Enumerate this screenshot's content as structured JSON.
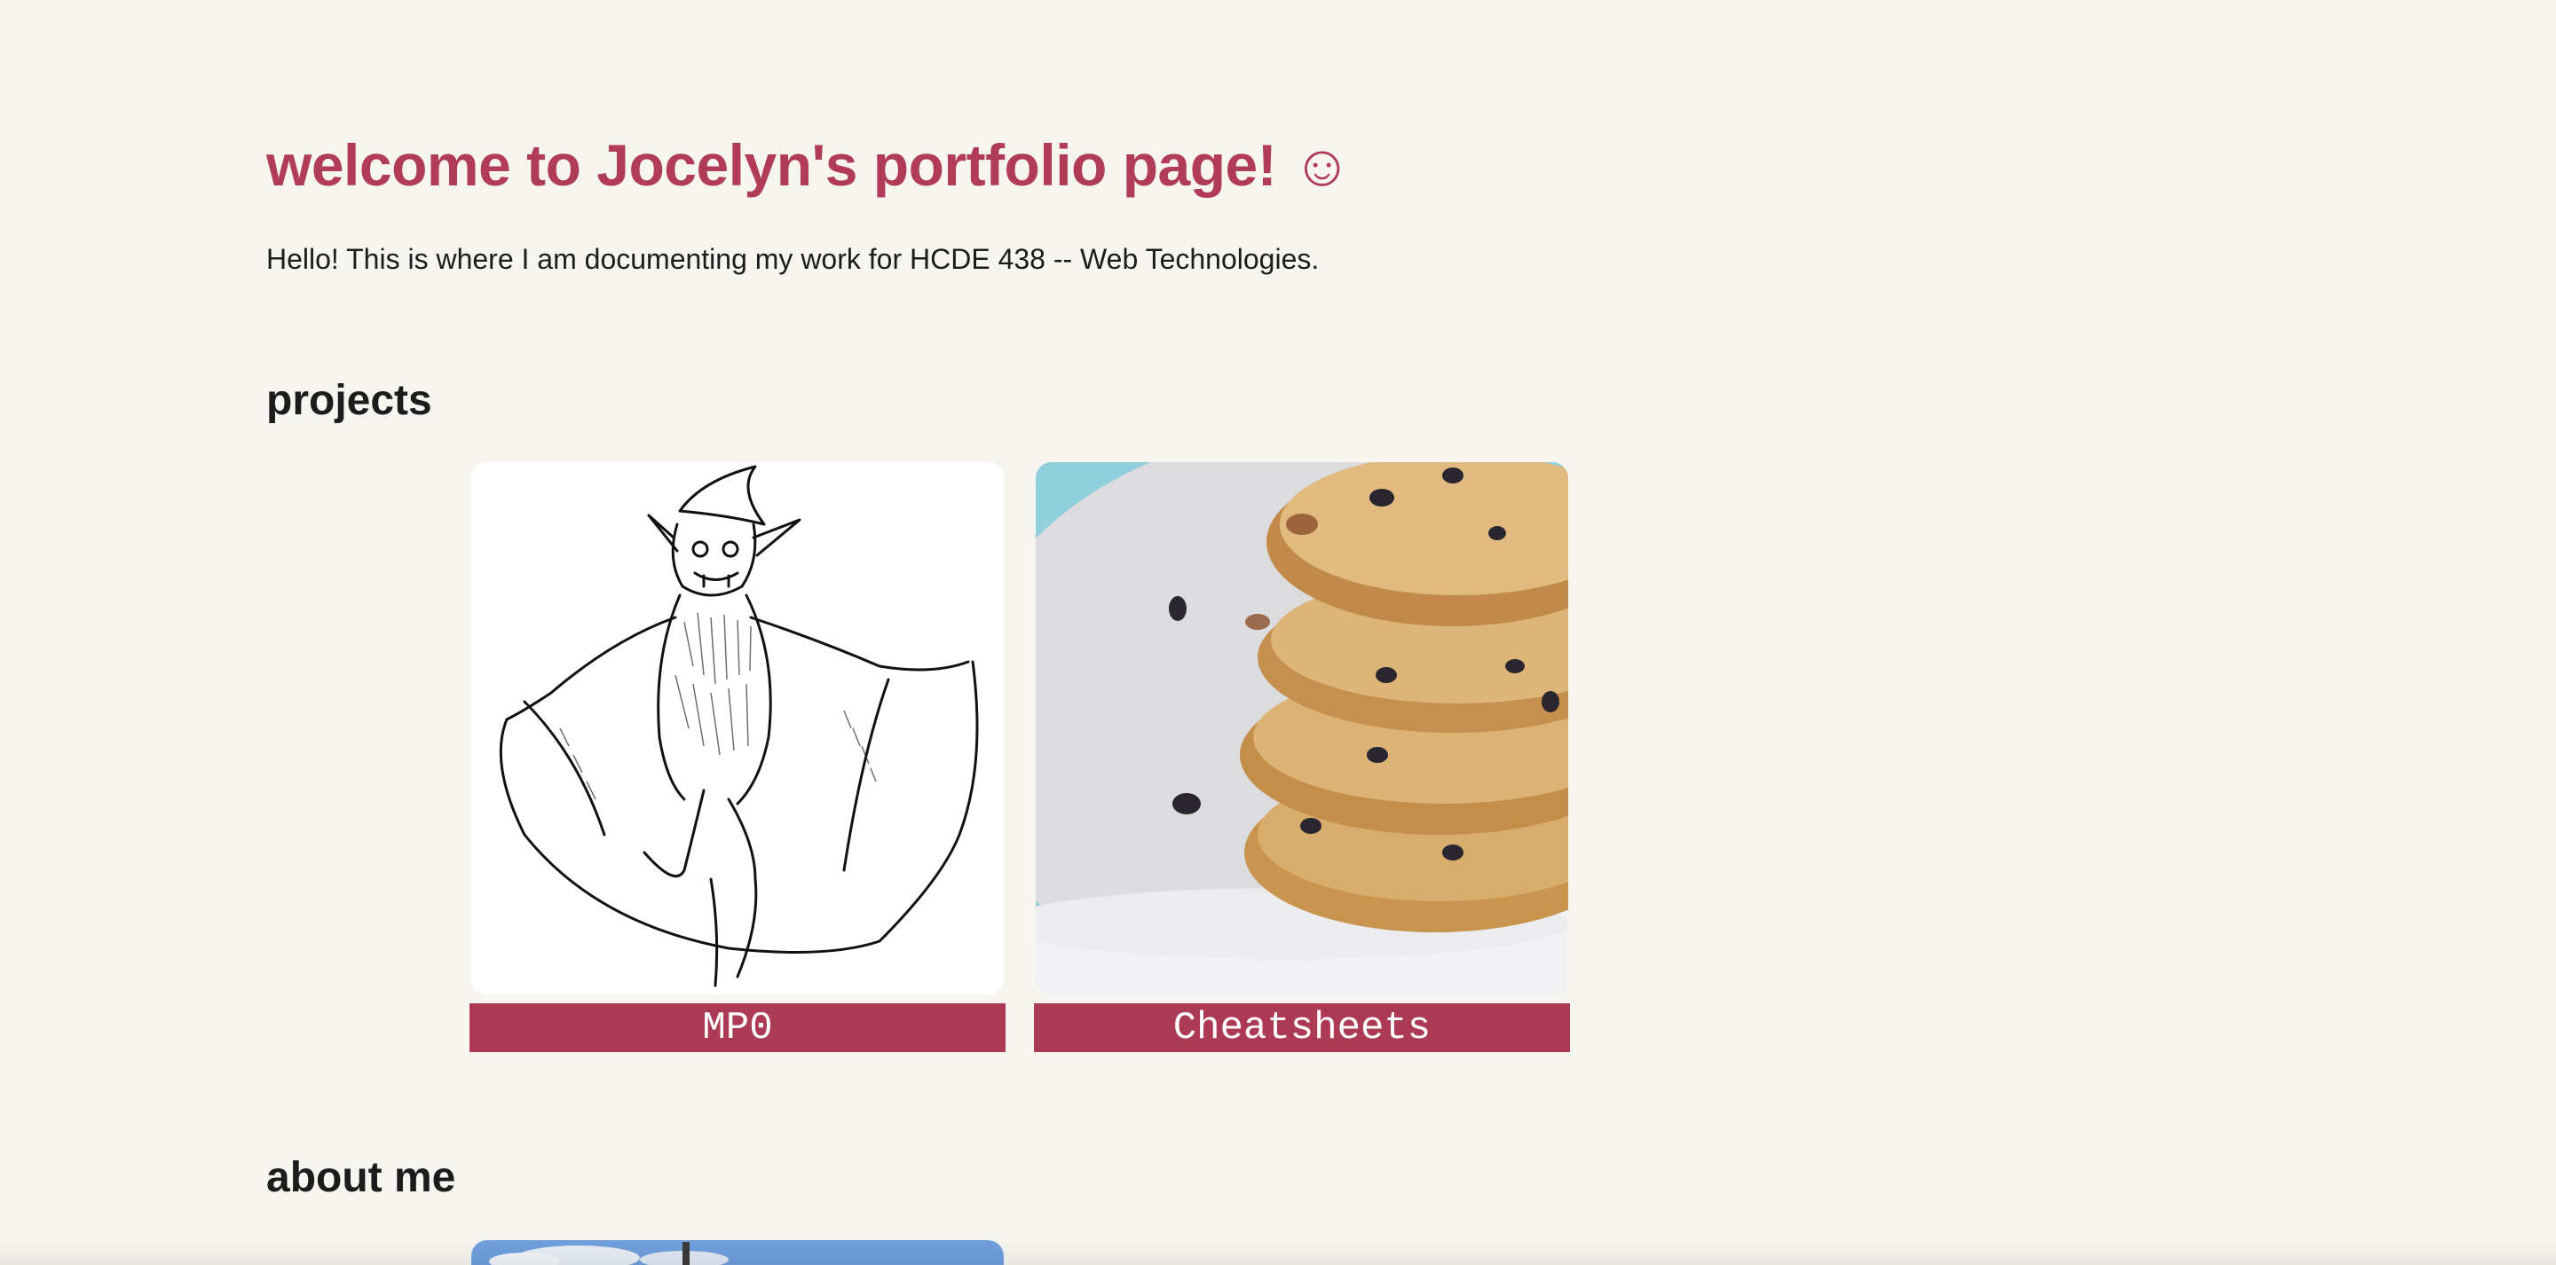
{
  "header": {
    "title": "welcome to Jocelyn's portfolio page! ☺",
    "intro": "Hello! This is where I am documenting my work for HCDE 438 -- Web Technologies."
  },
  "projects": {
    "heading": "projects",
    "items": [
      {
        "label": "MP0",
        "image": "dancing-goblin-illustration"
      },
      {
        "label": "Cheatsheets",
        "image": "oatmeal-raisin-cookies-photo"
      }
    ]
  },
  "about": {
    "heading": "about me",
    "image": "sky-photo"
  },
  "colors": {
    "accent": "#b03c58",
    "label_bg": "#ad3a55",
    "background": "#f7f5f0",
    "text": "#1c1c1c"
  }
}
